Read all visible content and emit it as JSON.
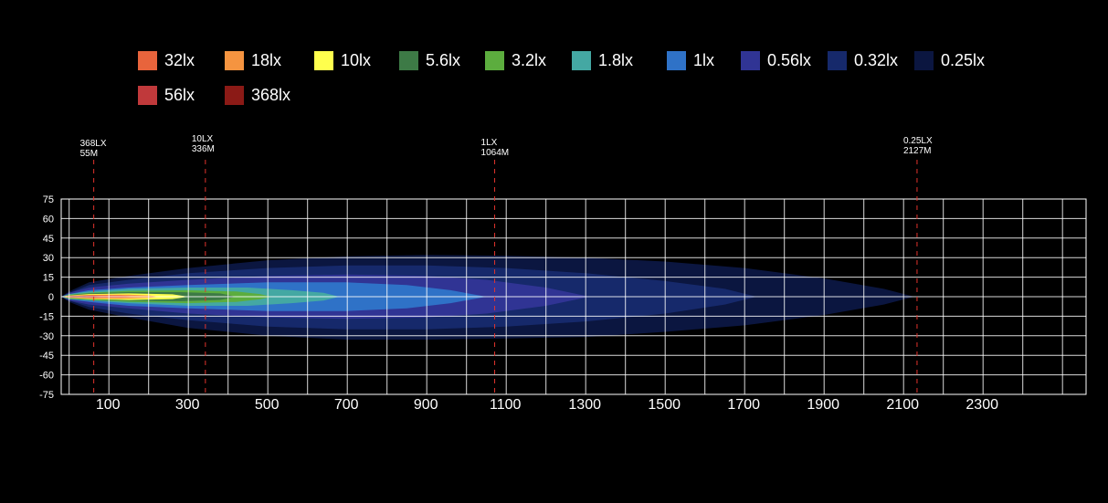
{
  "chart_data": {
    "type": "area",
    "title": "",
    "xlabel": "",
    "ylabel": "",
    "xlim": [
      -20,
      2600
    ],
    "ylim": [
      -75,
      75
    ],
    "x_ticks": [
      100,
      300,
      500,
      700,
      900,
      1100,
      1300,
      1500,
      1700,
      1900,
      2100,
      2300
    ],
    "y_ticks": [
      75,
      60,
      45,
      30,
      15,
      0,
      -15,
      -30,
      -45,
      -60,
      -75
    ],
    "grid": true,
    "grid_x_step": 100,
    "grid_y_step": 15,
    "legend_position": "top",
    "legend": [
      {
        "label": "32lx",
        "color": "#e8643c"
      },
      {
        "label": "18lx",
        "color": "#f59440"
      },
      {
        "label": "10lx",
        "color": "#ffff4d"
      },
      {
        "label": "5.6lx",
        "color": "#3d7a46"
      },
      {
        "label": "3.2lx",
        "color": "#5cad3e"
      },
      {
        "label": "1.8lx",
        "color": "#44a8a3"
      },
      {
        "label": "1lx",
        "color": "#2f72c7"
      },
      {
        "label": "0.56lx",
        "color": "#303494"
      },
      {
        "label": "0.32lx",
        "color": "#16296b"
      },
      {
        "label": "0.25lx",
        "color": "#0b1640"
      },
      {
        "label": "56lx",
        "color": "#c0393b"
      },
      {
        "label": "368lx",
        "color": "#8b1a16"
      }
    ],
    "series": [
      {
        "name": "0.25lx",
        "color": "#0b1640",
        "points": [
          [
            -20,
            0
          ],
          [
            0,
            4
          ],
          [
            50,
            11
          ],
          [
            150,
            16
          ],
          [
            300,
            22
          ],
          [
            500,
            28
          ],
          [
            700,
            31
          ],
          [
            900,
            32
          ],
          [
            1100,
            31.5
          ],
          [
            1300,
            30
          ],
          [
            1500,
            27
          ],
          [
            1700,
            22
          ],
          [
            1900,
            14
          ],
          [
            2050,
            6
          ],
          [
            2127,
            0
          ],
          [
            2050,
            -6
          ],
          [
            1900,
            -14
          ],
          [
            1700,
            -22
          ],
          [
            1500,
            -27
          ],
          [
            1300,
            -31
          ],
          [
            1100,
            -32
          ],
          [
            900,
            -33
          ],
          [
            700,
            -33
          ],
          [
            500,
            -30
          ],
          [
            300,
            -24
          ],
          [
            150,
            -16
          ],
          [
            50,
            -10
          ],
          [
            0,
            -4
          ]
        ]
      },
      {
        "name": "0.32lx",
        "color": "#16296b",
        "points": [
          [
            -20,
            0
          ],
          [
            0,
            3
          ],
          [
            50,
            9
          ],
          [
            150,
            13
          ],
          [
            300,
            18
          ],
          [
            500,
            22
          ],
          [
            700,
            24
          ],
          [
            900,
            24
          ],
          [
            1100,
            22
          ],
          [
            1300,
            18
          ],
          [
            1500,
            12
          ],
          [
            1650,
            6
          ],
          [
            1730,
            0
          ],
          [
            1650,
            -6
          ],
          [
            1500,
            -13
          ],
          [
            1300,
            -19
          ],
          [
            1100,
            -23
          ],
          [
            900,
            -25
          ],
          [
            700,
            -25
          ],
          [
            500,
            -23
          ],
          [
            300,
            -18
          ],
          [
            150,
            -13
          ],
          [
            50,
            -8
          ],
          [
            0,
            -3
          ]
        ]
      },
      {
        "name": "0.56lx",
        "color": "#303494",
        "points": [
          [
            -20,
            0
          ],
          [
            0,
            3
          ],
          [
            50,
            7
          ],
          [
            150,
            10
          ],
          [
            300,
            13
          ],
          [
            500,
            16
          ],
          [
            700,
            17
          ],
          [
            900,
            16
          ],
          [
            1050,
            13
          ],
          [
            1200,
            7
          ],
          [
            1310,
            0
          ],
          [
            1200,
            -7
          ],
          [
            1050,
            -13
          ],
          [
            900,
            -16
          ],
          [
            700,
            -17
          ],
          [
            500,
            -16
          ],
          [
            300,
            -13
          ],
          [
            150,
            -9
          ],
          [
            50,
            -6
          ],
          [
            0,
            -3
          ]
        ]
      },
      {
        "name": "1lx",
        "color": "#2f72c7",
        "points": [
          [
            -20,
            0
          ],
          [
            0,
            2
          ],
          [
            50,
            5
          ],
          [
            150,
            7
          ],
          [
            300,
            9
          ],
          [
            500,
            11
          ],
          [
            700,
            11
          ],
          [
            850,
            9
          ],
          [
            960,
            5
          ],
          [
            1050,
            0
          ],
          [
            960,
            -5
          ],
          [
            850,
            -9
          ],
          [
            700,
            -11
          ],
          [
            500,
            -11
          ],
          [
            300,
            -9
          ],
          [
            150,
            -7
          ],
          [
            50,
            -4
          ],
          [
            0,
            -2
          ]
        ]
      },
      {
        "name": "1.8lx",
        "color": "#44a8a3",
        "points": [
          [
            -20,
            0
          ],
          [
            0,
            2
          ],
          [
            50,
            4
          ],
          [
            150,
            6
          ],
          [
            300,
            7
          ],
          [
            450,
            7
          ],
          [
            560,
            5
          ],
          [
            640,
            3
          ],
          [
            680,
            0
          ],
          [
            640,
            -3
          ],
          [
            560,
            -5
          ],
          [
            450,
            -7
          ],
          [
            300,
            -7
          ],
          [
            150,
            -5
          ],
          [
            50,
            -3
          ],
          [
            0,
            -2
          ]
        ]
      },
      {
        "name": "3.2lx",
        "color": "#5cad3e",
        "points": [
          [
            -20,
            0
          ],
          [
            0,
            1.5
          ],
          [
            50,
            3
          ],
          [
            150,
            4.5
          ],
          [
            300,
            5
          ],
          [
            420,
            4
          ],
          [
            480,
            2
          ],
          [
            510,
            0
          ],
          [
            480,
            -2
          ],
          [
            420,
            -4
          ],
          [
            300,
            -5
          ],
          [
            150,
            -4
          ],
          [
            50,
            -2.5
          ],
          [
            0,
            -1.5
          ]
        ]
      },
      {
        "name": "5.6lx",
        "color": "#3d7a46",
        "points": [
          [
            -20,
            0
          ],
          [
            0,
            1.2
          ],
          [
            50,
            2.5
          ],
          [
            150,
            3.5
          ],
          [
            280,
            3.5
          ],
          [
            380,
            2.5
          ],
          [
            420,
            0
          ],
          [
            380,
            -2.5
          ],
          [
            280,
            -3.5
          ],
          [
            150,
            -3
          ],
          [
            50,
            -2
          ],
          [
            0,
            -1.2
          ]
        ]
      },
      {
        "name": "10lx",
        "color": "#ffff4d",
        "points": [
          [
            -20,
            0
          ],
          [
            0,
            1
          ],
          [
            50,
            2
          ],
          [
            150,
            2.5
          ],
          [
            260,
            1.8
          ],
          [
            300,
            0
          ],
          [
            260,
            -1.8
          ],
          [
            150,
            -2.5
          ],
          [
            50,
            -1.8
          ],
          [
            0,
            -1
          ]
        ]
      },
      {
        "name": "18lx",
        "color": "#f59440",
        "points": [
          [
            -20,
            0
          ],
          [
            0,
            0.8
          ],
          [
            60,
            1.5
          ],
          [
            150,
            1.6
          ],
          [
            200,
            1
          ],
          [
            230,
            0
          ],
          [
            200,
            -1
          ],
          [
            150,
            -1.5
          ],
          [
            60,
            -1.4
          ],
          [
            0,
            -0.8
          ]
        ]
      },
      {
        "name": "32lx",
        "color": "#e8643c",
        "points": [
          [
            -20,
            0
          ],
          [
            0,
            0.6
          ],
          [
            60,
            1.1
          ],
          [
            130,
            1
          ],
          [
            170,
            0
          ],
          [
            130,
            -1
          ],
          [
            60,
            -1
          ],
          [
            0,
            -0.6
          ]
        ]
      },
      {
        "name": "56lx",
        "color": "#c0393b",
        "points": [
          [
            -20,
            0
          ],
          [
            10,
            0.5
          ],
          [
            60,
            0.7
          ],
          [
            100,
            0
          ],
          [
            60,
            -0.7
          ],
          [
            10,
            -0.5
          ]
        ]
      },
      {
        "name": "368lx",
        "color": "#8b1a16",
        "points": [
          [
            -20,
            0
          ],
          [
            0,
            0.4
          ],
          [
            40,
            0.45
          ],
          [
            55,
            0
          ],
          [
            40,
            -0.45
          ],
          [
            0,
            -0.4
          ]
        ]
      }
    ],
    "markers": [
      {
        "x": 55,
        "line1": "368LX",
        "line2": "55M"
      },
      {
        "x": 336,
        "line1": "10LX",
        "line2": "336M"
      },
      {
        "x": 1064,
        "line1": "1LX",
        "line2": "1064M"
      },
      {
        "x": 2127,
        "line1": "0.25LX",
        "line2": "2127M"
      }
    ],
    "colors": {
      "background": "#000000",
      "grid": "#ffffff",
      "marker_line": "#e0332c",
      "text": "#ffffff"
    }
  }
}
